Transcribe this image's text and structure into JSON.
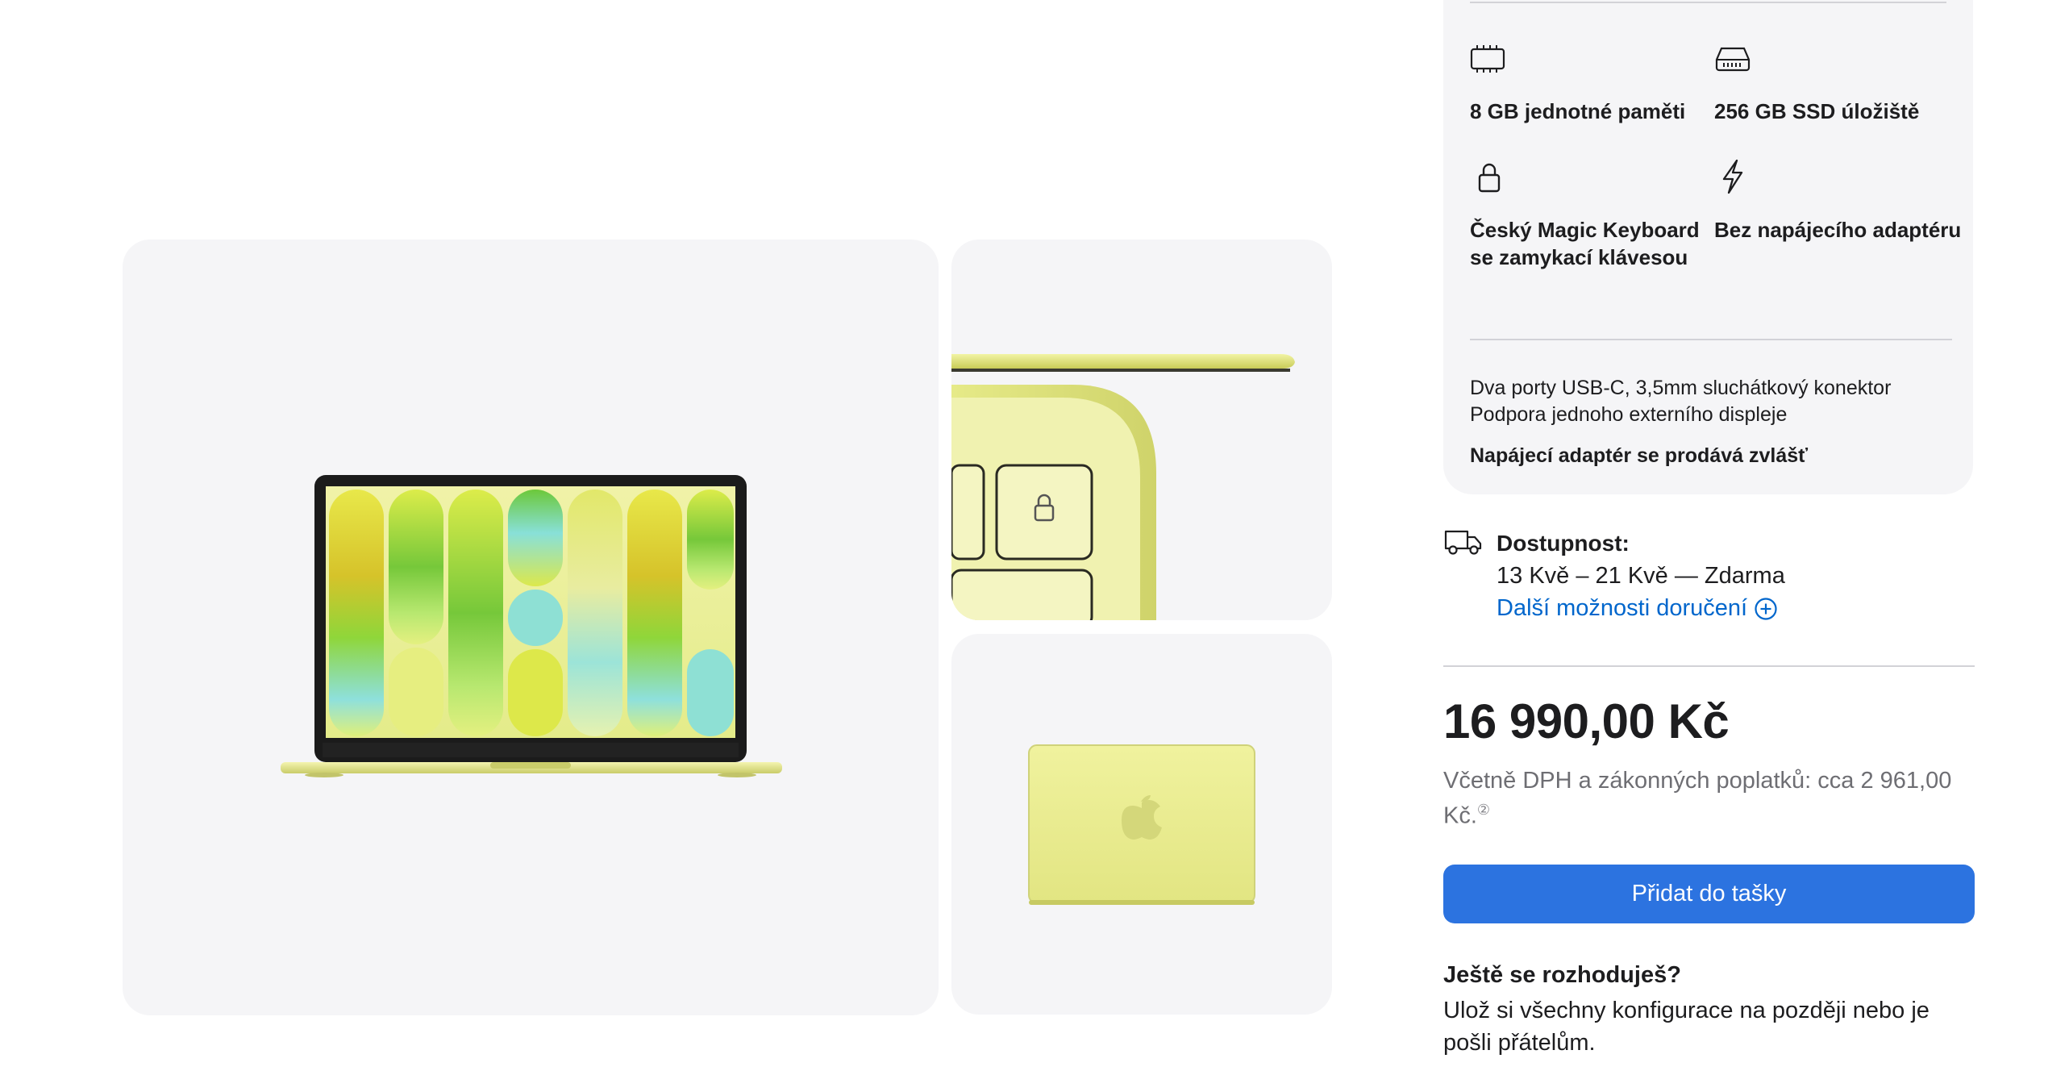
{
  "specs": {
    "items": [
      {
        "icon": "memory-chip-icon",
        "label": "8 GB jednotné paměti"
      },
      {
        "icon": "storage-drive-icon",
        "label": "256 GB SSD úložiště"
      },
      {
        "icon": "lock-icon",
        "label_line1": "Český Magic Keyboard",
        "label_line2": "se zamykací klávesou"
      },
      {
        "icon": "lightning-bolt-icon",
        "label": "Bez napájecího adaptéru"
      }
    ],
    "ports_line1": "Dva porty USB-C, 3,5mm sluchátkový konektor",
    "ports_line2": "Podpora jednoho externího displeje",
    "adapter_note": "Napájecí adaptér se prodává zvlášť"
  },
  "availability": {
    "icon": "delivery-truck-icon",
    "title": "Dostupnost:",
    "dates": "13 Kvě – 21 Kvě — Zdarma",
    "more_link": "Další možnosti doručení",
    "more_icon": "plus-circle-icon"
  },
  "price": {
    "amount": "16 990,00 Kč",
    "vat_text": "Včetně DPH a zákonných poplatků: cca 2 961,00 Kč.",
    "footnote": "②"
  },
  "cart": {
    "button_label": "Přidat do tašky"
  },
  "undecided": {
    "title": "Ještě se rozhoduješ?",
    "text": "Ulož si všechny konfigurace na později nebo je pošli přátelům."
  },
  "colors": {
    "accent_blue": "#0066cc",
    "button_blue": "#2c73e0",
    "tile_bg": "#f5f5f7",
    "product_yellow": "#ecef9a"
  }
}
